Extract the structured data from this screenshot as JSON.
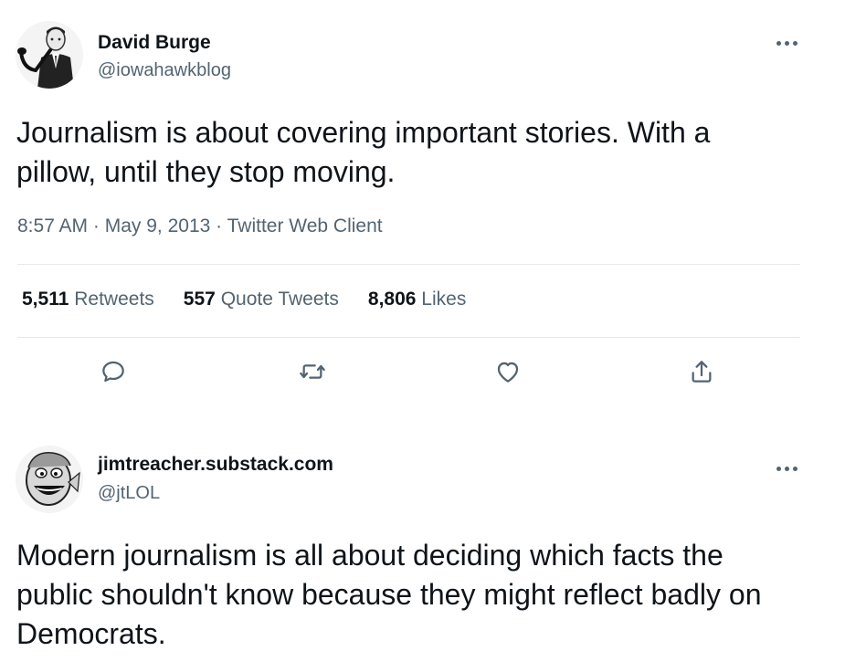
{
  "tweet1": {
    "name": "David Burge",
    "handle": "@iowahawkblog",
    "text": "Journalism is about covering important stories. With a pillow, until they stop moving.",
    "time": "8:57 AM",
    "sep1": " · ",
    "date": "May 9, 2013",
    "sep2": " · ",
    "client": "Twitter Web Client",
    "retweets_count": "5,511",
    "retweets_label": "Retweets",
    "quotes_count": "557",
    "quotes_label": "Quote Tweets",
    "likes_count": "8,806",
    "likes_label": "Likes",
    "icons": [
      "reply-icon",
      "retweet-icon",
      "like-icon",
      "share-icon"
    ]
  },
  "tweet2": {
    "name": "jimtreacher.substack.com",
    "handle": "@jtLOL",
    "text": "Modern journalism is all about deciding which facts the public shouldn't know because they might reflect badly on Democrats."
  },
  "colors": {
    "text": "#0f1419",
    "secondary": "#536471",
    "divider": "#e4e8eb"
  }
}
